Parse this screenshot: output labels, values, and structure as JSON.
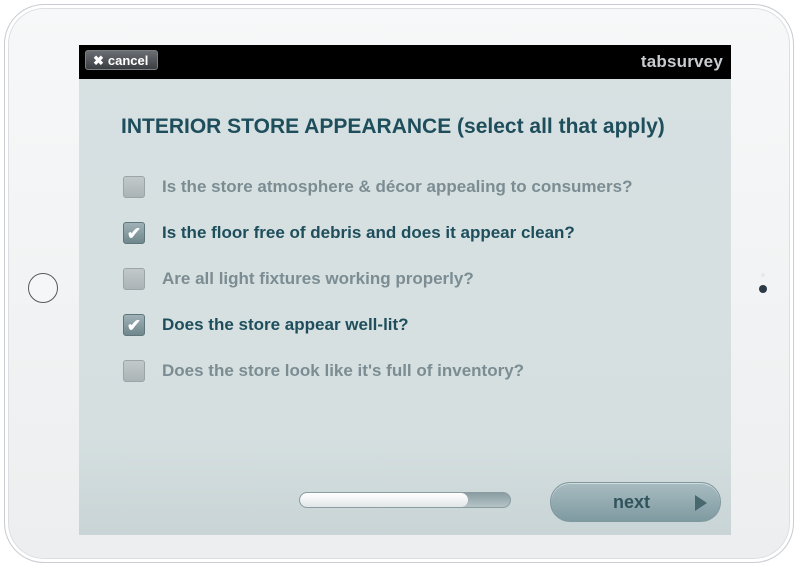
{
  "topbar": {
    "cancel_label": "cancel",
    "cancel_icon": "✖",
    "brand": "tabsurvey"
  },
  "question": {
    "title": "INTERIOR STORE APPEARANCE (select all that apply)",
    "options": [
      {
        "label": "Is the store atmosphere & décor appealing to consumers?",
        "checked": false
      },
      {
        "label": "Is the floor free of debris and does it appear clean?",
        "checked": true
      },
      {
        "label": "Are all light fixtures working properly?",
        "checked": false
      },
      {
        "label": "Does the store appear well-lit?",
        "checked": true
      },
      {
        "label": "Does the store look like it's full of inventory?",
        "checked": false
      }
    ],
    "check_glyph": "✔"
  },
  "footer": {
    "progress_fraction": 0.8,
    "next_label": "next"
  },
  "colors": {
    "accent": "#1e4e5c",
    "muted_text": "#7b8d93",
    "screen_bg": "#d7e1e2"
  }
}
